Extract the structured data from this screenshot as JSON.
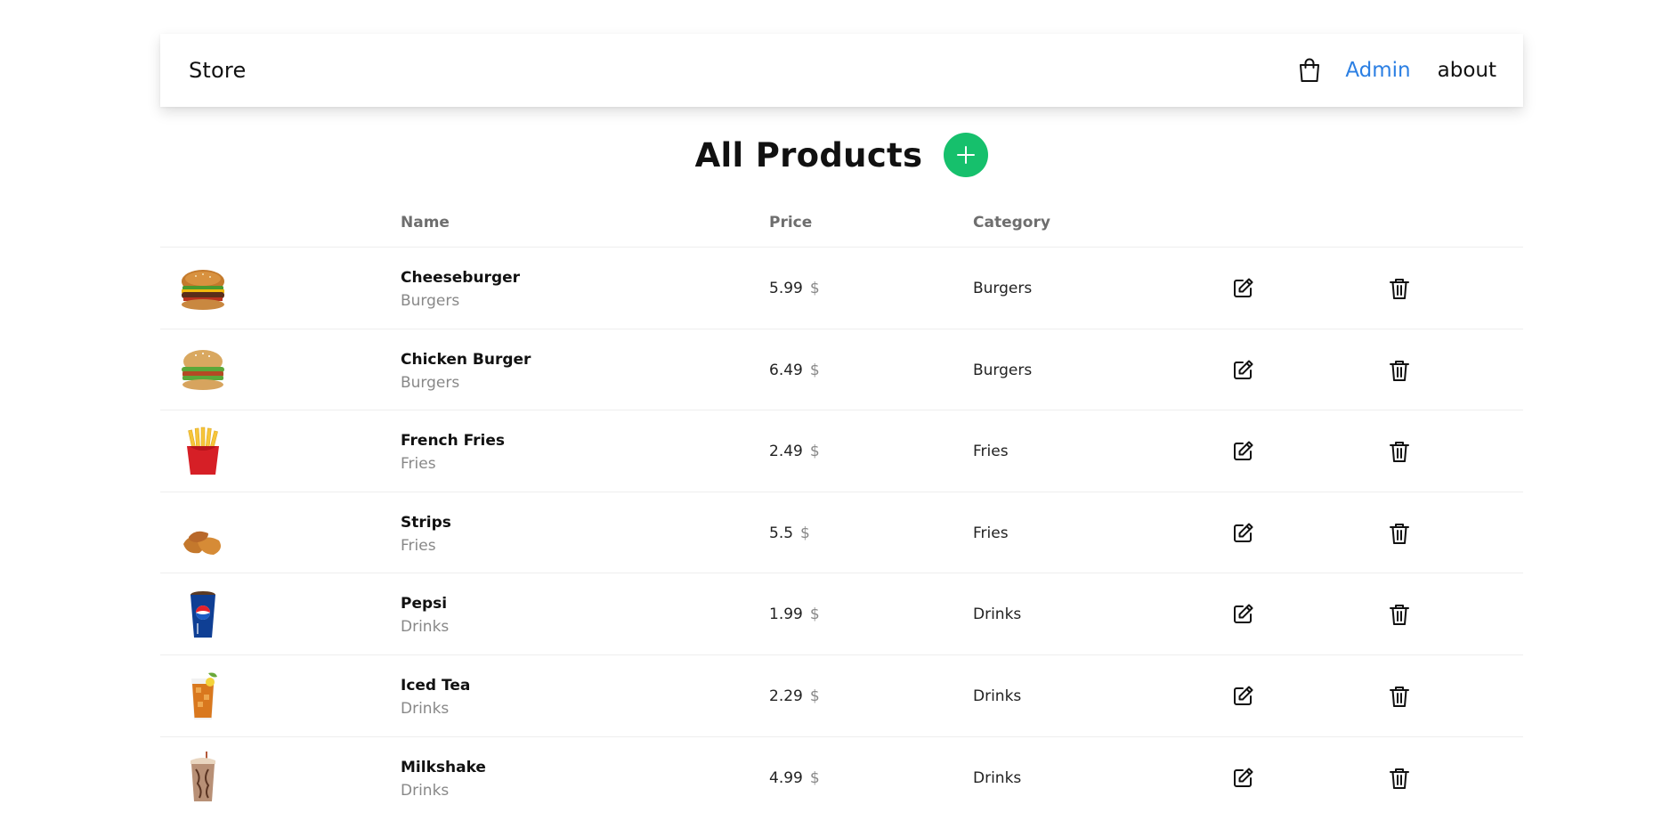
{
  "navbar": {
    "brand": "Store",
    "cart_icon": "shopping-bag-icon",
    "links": [
      {
        "label": "Admin",
        "color": "#2b7fe3"
      },
      {
        "label": "about"
      }
    ]
  },
  "main": {
    "title": "All Products",
    "add_icon": "plus-icon",
    "add_color": "#16c06c"
  },
  "table": {
    "columns": [
      "Name",
      "Price",
      "Category"
    ],
    "currency": "$",
    "rows": [
      {
        "name": "Cheeseburger",
        "category": "Burgers",
        "price": "5.99",
        "image": "cheeseburger-image"
      },
      {
        "name": "Chicken Burger",
        "category": "Burgers",
        "price": "6.49",
        "image": "chicken-burger-image"
      },
      {
        "name": "French Fries",
        "category": "Fries",
        "price": "2.49",
        "image": "french-fries-image"
      },
      {
        "name": "Strips",
        "category": "Fries",
        "price": "5.5",
        "image": "chicken-strips-image"
      },
      {
        "name": "Pepsi",
        "category": "Drinks",
        "price": "1.99",
        "image": "pepsi-cup-image"
      },
      {
        "name": "Iced Tea",
        "category": "Drinks",
        "price": "2.29",
        "image": "iced-tea-image"
      },
      {
        "name": "Milkshake",
        "category": "Drinks",
        "price": "4.99",
        "image": "milkshake-image"
      }
    ],
    "row_actions": [
      "edit-icon",
      "trash-icon"
    ]
  }
}
